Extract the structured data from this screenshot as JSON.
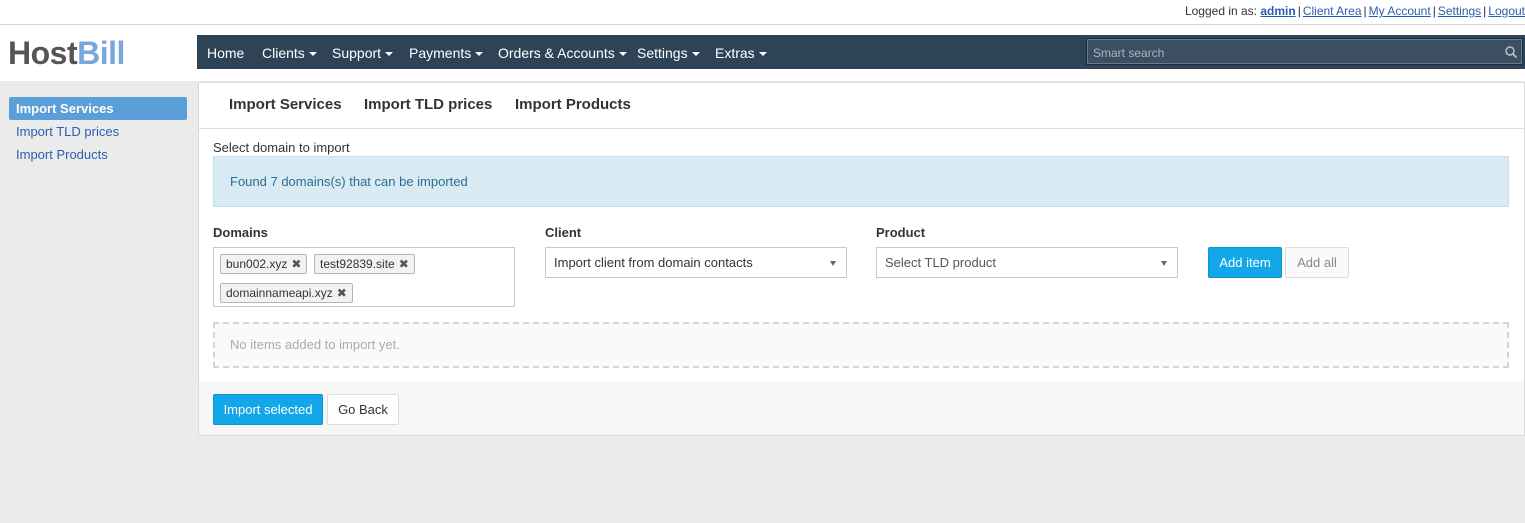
{
  "topbar": {
    "logged_in_label": "Logged in as:",
    "user": "admin",
    "links": [
      "Client Area",
      "My Account",
      "Settings",
      "Logout"
    ]
  },
  "brand": {
    "part1": "Host",
    "part2": "Bill"
  },
  "nav": {
    "items": [
      {
        "label": "Home",
        "dropdown": false
      },
      {
        "label": "Clients",
        "dropdown": true
      },
      {
        "label": "Support",
        "dropdown": true
      },
      {
        "label": "Payments",
        "dropdown": true
      },
      {
        "label": "Orders & Accounts",
        "dropdown": true
      },
      {
        "label": "Settings",
        "dropdown": true
      },
      {
        "label": "Extras",
        "dropdown": true
      }
    ],
    "search_placeholder": "Smart search"
  },
  "sidebar": {
    "items": [
      {
        "label": "Import Services",
        "active": true
      },
      {
        "label": "Import TLD prices",
        "active": false
      },
      {
        "label": "Import Products",
        "active": false
      }
    ]
  },
  "tabs": [
    "Import Services",
    "Import TLD prices",
    "Import Products"
  ],
  "main": {
    "select_label": "Select domain to import",
    "alert": "Found 7 domains(s) that can be imported",
    "domains_label": "Domains",
    "domains": [
      "bun002.xyz",
      "test92839.site",
      "domainnameapi.xyz"
    ],
    "client_label": "Client",
    "client_value": "Import client from domain contacts",
    "product_label": "Product",
    "product_placeholder": "Select TLD product",
    "add_item": "Add item",
    "add_all": "Add all",
    "empty_text": "No items added to import yet.",
    "import_selected": "Import selected",
    "go_back": "Go Back"
  },
  "colors": {
    "navbar": "#2f4356",
    "primary_button": "#12a7e8",
    "sidebar_active": "#5b9fd8",
    "alert_bg": "#d8ebf5",
    "link": "#2a5db0"
  }
}
